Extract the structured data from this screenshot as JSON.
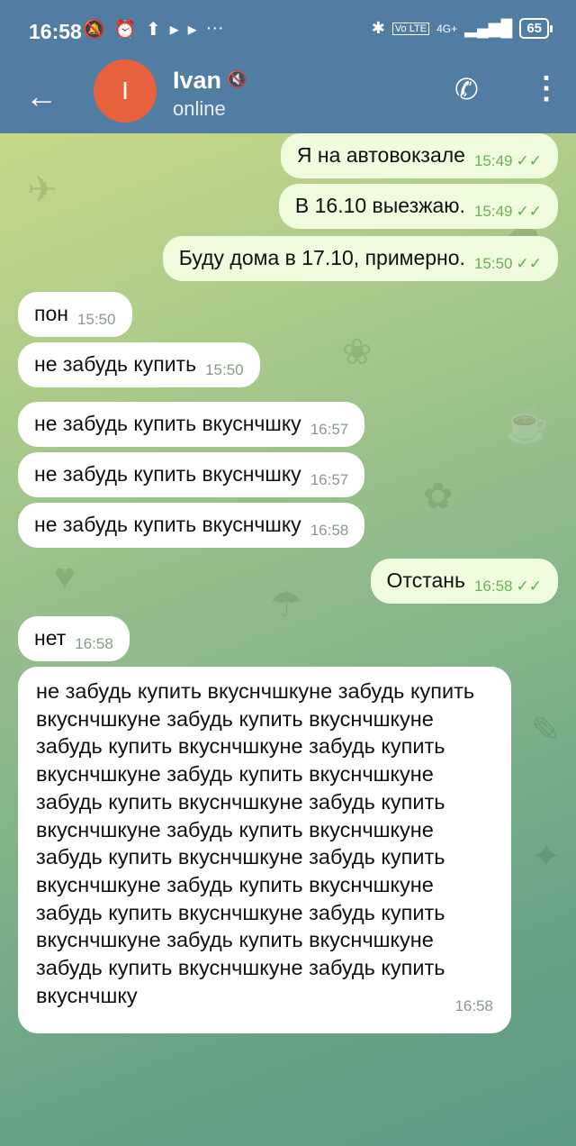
{
  "status_bar": {
    "time": "16:58",
    "left_icons": [
      "mute-icon",
      "alarm-icon",
      "upload-icon",
      "play-icon",
      "play-icon",
      "more-dots"
    ],
    "network": "4G+",
    "battery": "65"
  },
  "header": {
    "avatar_letter": "I",
    "contact_name": "Ivan",
    "status": "online",
    "accent": "#517da2",
    "avatar_color": "#e8613f"
  },
  "messages": [
    {
      "dir": "out",
      "text": "Я на автовокзале",
      "time": "15:49"
    },
    {
      "dir": "out",
      "text": "В 16.10 выезжаю.",
      "time": "15:49"
    },
    {
      "dir": "out",
      "text": "Буду дома в 17.10, примерно.",
      "time": "15:50"
    },
    {
      "dir": "in",
      "text": "пон",
      "time": "15:50"
    },
    {
      "dir": "in",
      "text": "не забудь купить",
      "time": "15:50"
    },
    {
      "dir": "in",
      "text": "не забудь купить вкуснчшку",
      "time": "16:57"
    },
    {
      "dir": "in",
      "text": "не забудь купить вкуснчшку",
      "time": "16:57"
    },
    {
      "dir": "in",
      "text": "не забудь купить вкуснчшку",
      "time": "16:58"
    },
    {
      "dir": "out",
      "text": "Отстань",
      "time": "16:58"
    },
    {
      "dir": "in",
      "text": "нет",
      "time": "16:58"
    },
    {
      "dir": "in",
      "text": "не забудь купить вкуснчшкуне забудь купить вкуснчшкуне забудь купить вкуснчшкуне забудь купить вкуснчшкуне забудь купить вкуснчшкуне забудь купить вкуснчшкуне забудь купить вкуснчшкуне забудь купить вкуснчшкуне забудь купить вкуснчшкуне забудь купить вкуснчшкуне забудь купить вкуснчшкуне забудь купить вкуснчшкуне забудь купить вкуснчшкуне забудь купить вкуснчшкуне забудь купить вкуснчшкуне забудь купить вкуснчшкуне забудь купить вкуснчшку",
      "time": "16:58"
    }
  ]
}
